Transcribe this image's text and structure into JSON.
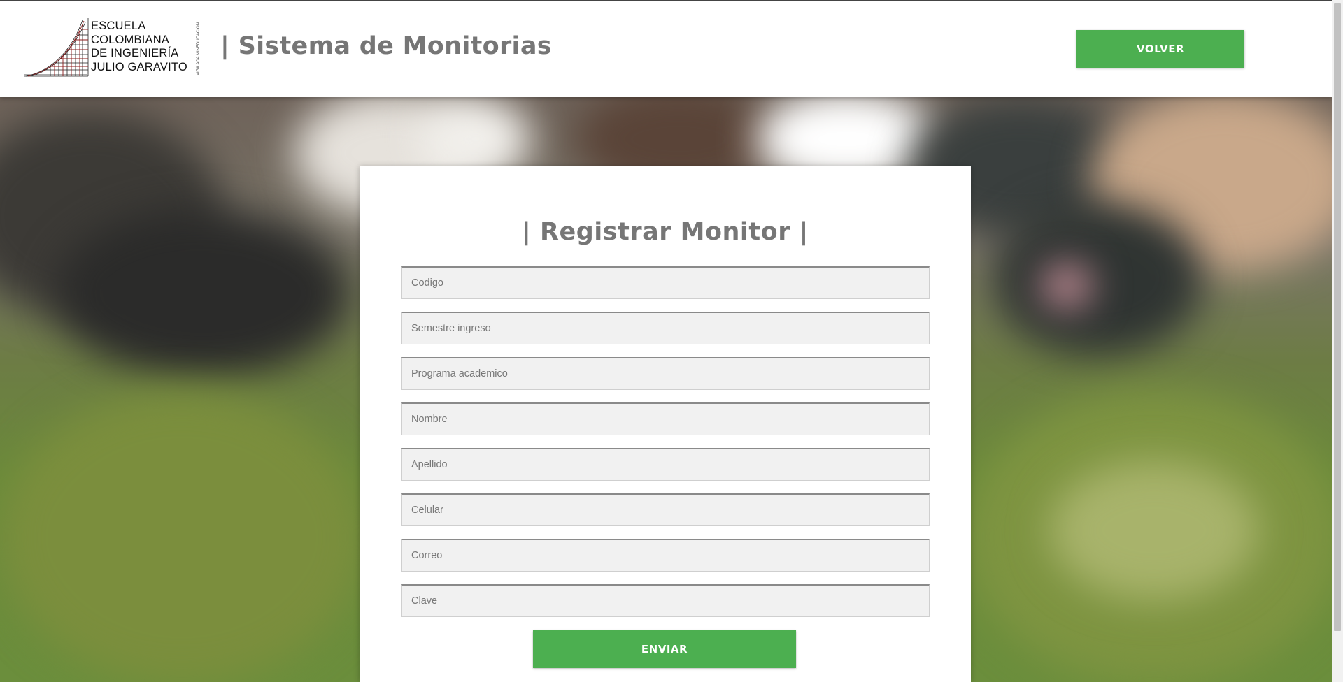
{
  "logo": {
    "lines": [
      "ESCUELA",
      "COLOMBIANA",
      "DE INGENIERÍA",
      "JULIO GARAVITO"
    ],
    "vertical_text": "VIGILADA MINEDUCACIÓN"
  },
  "header": {
    "title": "| Sistema de Monitorias",
    "back_label": "VOLVER"
  },
  "form": {
    "title": "| Registrar Monitor |",
    "fields": [
      {
        "placeholder": "Codigo"
      },
      {
        "placeholder": "Semestre ingreso"
      },
      {
        "placeholder": "Programa academico"
      },
      {
        "placeholder": "Nombre"
      },
      {
        "placeholder": "Apellido"
      },
      {
        "placeholder": "Celular"
      },
      {
        "placeholder": "Correo"
      },
      {
        "placeholder": "Clave"
      }
    ],
    "submit_label": "ENVIAR"
  },
  "colors": {
    "accent": "#4caf50",
    "title_gray": "#767676",
    "field_bg": "#f1f1f1"
  }
}
